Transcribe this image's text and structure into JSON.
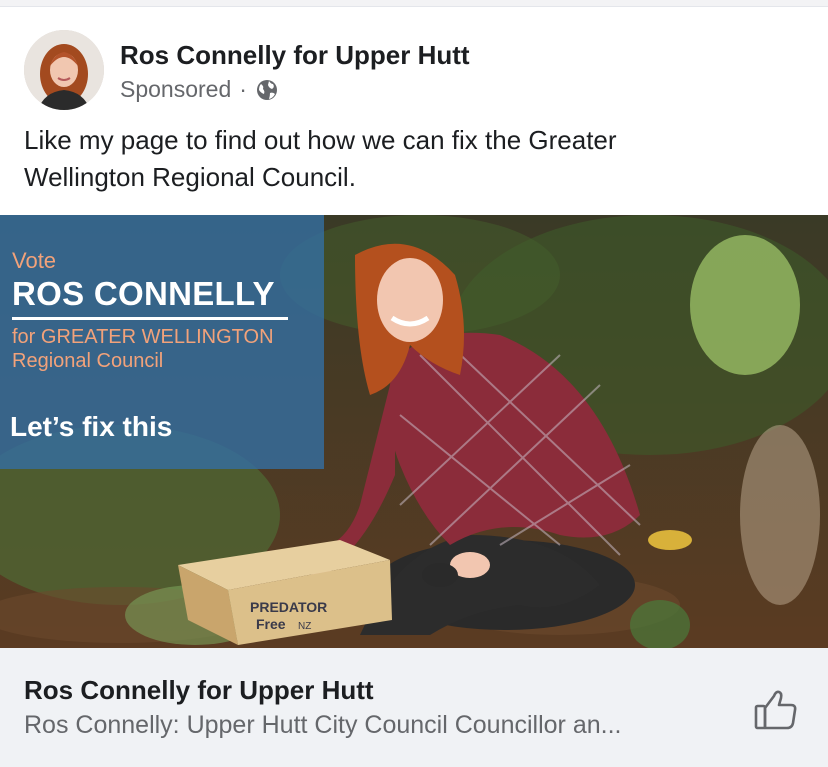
{
  "post": {
    "page_name": "Ros Connelly for Upper Hutt",
    "sponsored_label": "Sponsored",
    "separator": "·",
    "audience_icon": "globe-icon",
    "text_line1": "Like my page to find out how we can fix the Greater",
    "text_line2": "Wellington Regional Council."
  },
  "ad_image": {
    "vote": "Vote",
    "candidate": "ROS CONNELLY",
    "for_line1": "for GREATER WELLINGTON",
    "for_line2": "Regional Council",
    "slogan": "Let’s fix this",
    "box_text1": "PREDATOR",
    "box_text2": "Free",
    "box_text3": "NZ"
  },
  "link_card": {
    "title": "Ros Connelly for Upper Hutt",
    "description": "Ros Connelly: Upper Hutt City Council Councillor an...",
    "like_icon": "thumbs-up-icon"
  },
  "colors": {
    "text_primary": "#1c1e21",
    "text_secondary": "#65676b",
    "card_bg": "#f0f2f5",
    "overlay_blue": "#346ea0",
    "overlay_accent": "#f2a27a"
  }
}
